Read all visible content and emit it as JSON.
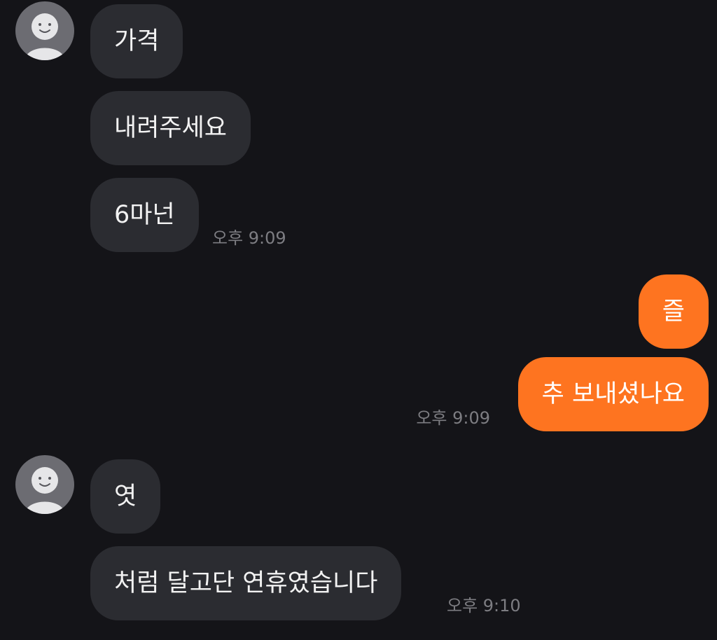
{
  "colors": {
    "background": "#141418",
    "incoming_bubble": "#2b2c31",
    "outgoing_bubble": "#fe7420",
    "timestamp": "#7d7d82"
  },
  "avatar_icon": "default-person-icon",
  "chat": {
    "group1": {
      "messages": [
        "가격",
        "내려주세요",
        "6마넌"
      ],
      "time": "오후 9:09"
    },
    "group2": {
      "messages": [
        "즐",
        "추 보내셨나요"
      ],
      "time": "오후 9:09"
    },
    "group3": {
      "messages": [
        "엿",
        "처럼 달고단 연휴였습니다"
      ],
      "time": "오후 9:10"
    }
  }
}
